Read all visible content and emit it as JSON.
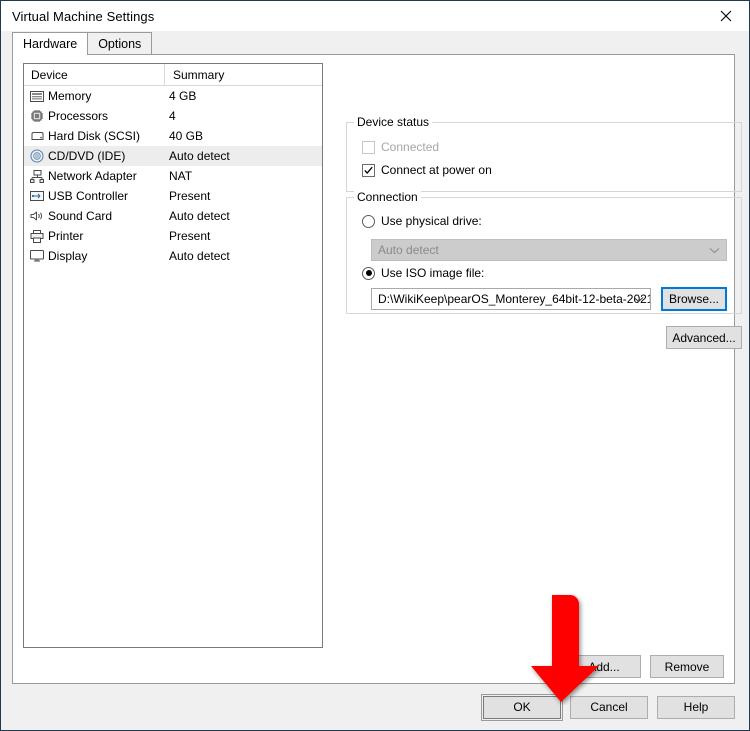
{
  "window": {
    "title": "Virtual Machine Settings",
    "close_icon": "close-icon"
  },
  "tabs": [
    {
      "label": "Hardware",
      "active": true
    },
    {
      "label": "Options",
      "active": false
    }
  ],
  "device_list": {
    "columns": [
      "Device",
      "Summary"
    ],
    "rows": [
      {
        "device": "Memory",
        "summary": "4 GB",
        "icon": "memory-icon",
        "selected": false
      },
      {
        "device": "Processors",
        "summary": "4",
        "icon": "processor-icon",
        "selected": false
      },
      {
        "device": "Hard Disk (SCSI)",
        "summary": "40 GB",
        "icon": "hard-disk-icon",
        "selected": false
      },
      {
        "device": "CD/DVD (IDE)",
        "summary": "Auto detect",
        "icon": "cd-dvd-icon",
        "selected": true
      },
      {
        "device": "Network Adapter",
        "summary": "NAT",
        "icon": "network-adapter-icon",
        "selected": false
      },
      {
        "device": "USB Controller",
        "summary": "Present",
        "icon": "usb-controller-icon",
        "selected": false
      },
      {
        "device": "Sound Card",
        "summary": "Auto detect",
        "icon": "sound-card-icon",
        "selected": false
      },
      {
        "device": "Printer",
        "summary": "Present",
        "icon": "printer-icon",
        "selected": false
      },
      {
        "device": "Display",
        "summary": "Auto detect",
        "icon": "display-icon",
        "selected": false
      }
    ],
    "add_label": "Add...",
    "remove_label": "Remove"
  },
  "device_status": {
    "title": "Device status",
    "connected": {
      "label": "Connected",
      "checked": false,
      "enabled": false
    },
    "connect_at_power_on": {
      "label": "Connect at power on",
      "checked": true,
      "enabled": true
    }
  },
  "connection": {
    "title": "Connection",
    "use_physical_drive": {
      "label": "Use physical drive:",
      "selected": false
    },
    "physical_drive_value": "Auto detect",
    "use_iso_image": {
      "label": "Use ISO image file:",
      "selected": true
    },
    "iso_path": "D:\\WikiKeep\\pearOS_Monterey_64bit-12-beta-2021",
    "browse_label": "Browse...",
    "advanced_label": "Advanced..."
  },
  "footer": {
    "ok_label": "OK",
    "cancel_label": "Cancel",
    "help_label": "Help"
  },
  "annotation": {
    "arrow_color": "#FF0000",
    "points_to": "OK"
  },
  "colors": {
    "accent": "#0078d7",
    "selection": "#ededed",
    "window_border": "#1f3b54"
  }
}
